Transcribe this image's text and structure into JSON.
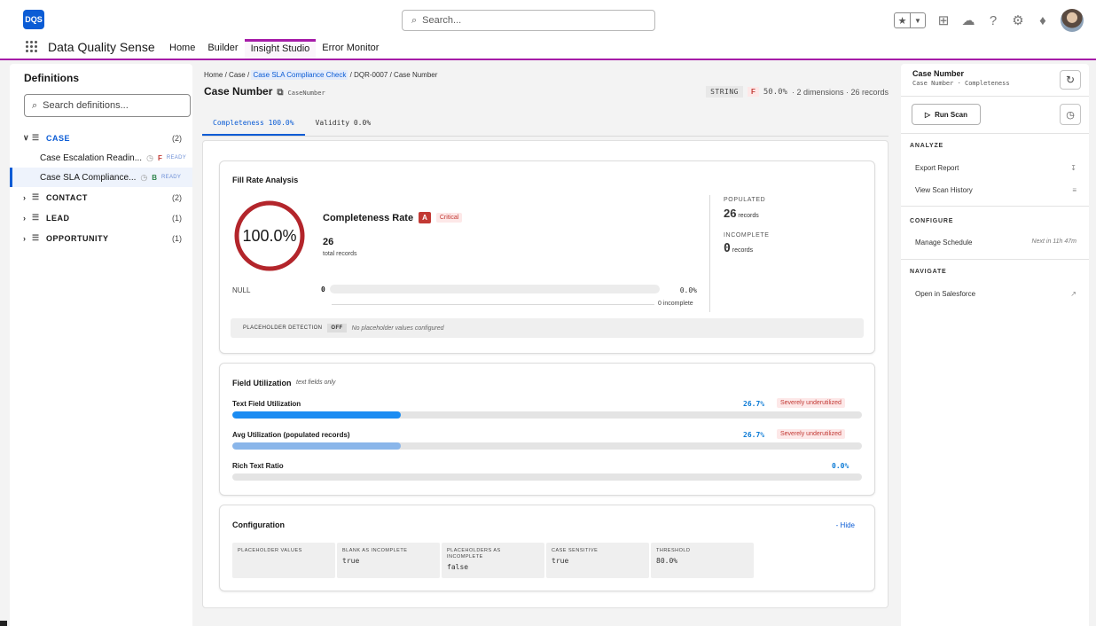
{
  "header": {
    "logo": "DQS",
    "search_placeholder": "Search...",
    "icons": [
      "favorites-star-icon",
      "favorites-dropdown-icon",
      "add-icon",
      "trailhead-icon",
      "help-icon",
      "setup-gear-icon",
      "notifications-bell-icon",
      "user-avatar"
    ]
  },
  "nav": {
    "app_name": "Data Quality Sense",
    "tabs": [
      {
        "label": "Home",
        "active": false
      },
      {
        "label": "Builder",
        "active": false
      },
      {
        "label": "Insight Studio",
        "active": true
      },
      {
        "label": "Error Monitor",
        "active": false
      }
    ]
  },
  "left": {
    "title": "Definitions",
    "search_placeholder": "Search definitions...",
    "objects": [
      {
        "name": "CASE",
        "count": "(2)",
        "expanded": true
      },
      {
        "name": "CONTACT",
        "count": "(2)",
        "expanded": false
      },
      {
        "name": "LEAD",
        "count": "(1)",
        "expanded": false
      },
      {
        "name": "OPPORTUNITY",
        "count": "(1)",
        "expanded": false
      }
    ],
    "definitions": [
      {
        "name": "Case Escalation Readin...",
        "grade": "F",
        "status": "READY"
      },
      {
        "name": "Case SLA Compliance...",
        "grade": "B",
        "status": "READY"
      }
    ]
  },
  "center": {
    "breadcrumb": {
      "home": "Home",
      "case": "Case",
      "check": "Case SLA Compliance Check",
      "id": "DQR-0007",
      "field": "Case Number",
      "sep": "/"
    },
    "field_title": "Case Number",
    "field_api": "CaseNumber",
    "field_type": "STRING",
    "field_grade": "F",
    "field_score": "50.0%",
    "field_meta": "· 2 dimensions · 26 records",
    "tabs": [
      "Completeness 100.0%",
      "Validity 0.0%"
    ],
    "fill": {
      "title": "Fill Rate Analysis",
      "ring_value": "100.0%",
      "rate_label": "Completeness Rate",
      "grade": "A",
      "severity": "Critical",
      "total": "26",
      "total_label": "total records",
      "null_label": "NULL",
      "null_count": "0",
      "null_pct": "0.0%",
      "incomplete": "0 incomplete",
      "populated_label": "POPULATED",
      "populated_value": "26",
      "populated_unit": "records",
      "incomplete_label": "INCOMPLETE",
      "incomplete_value": "0",
      "incomplete_unit": "records",
      "placeholder_label": "PLACEHOLDER DETECTION",
      "placeholder_state": "OFF",
      "placeholder_note": "No placeholder values configured"
    },
    "utilization": {
      "title": "Field Utilization",
      "subtitle": "text fields only",
      "rows": [
        {
          "label": "Text Field Utilization",
          "pct": "26.7%",
          "fraction": 0.267,
          "badge": "Severely underutilized",
          "color": "#1b8cf2"
        },
        {
          "label": "Avg Utilization (populated records)",
          "pct": "26.7%",
          "fraction": 0.267,
          "badge": "Severely underutilized",
          "color": "#8ab6ea"
        },
        {
          "label": "Rich Text Ratio",
          "pct": "0.0%",
          "fraction": 0,
          "badge": "",
          "color": "#1b8cf2"
        }
      ]
    },
    "config": {
      "title": "Configuration",
      "hide": "- Hide",
      "items": [
        {
          "label": "PLACEHOLDER VALUES",
          "value": ""
        },
        {
          "label": "BLANK AS INCOMPLETE",
          "value": "true"
        },
        {
          "label": "PLACEHOLDERS AS INCOMPLETE",
          "value": "false"
        },
        {
          "label": "CASE SENSITIVE",
          "value": "true"
        },
        {
          "label": "THRESHOLD",
          "value": "80.0%"
        }
      ]
    }
  },
  "right": {
    "title": "Case Number",
    "subtitle": "Case Number · Completeness",
    "run_scan": "Run Scan",
    "analyze_label": "ANALYZE",
    "export": "Export Report",
    "history": "View Scan History",
    "configure_label": "CONFIGURE",
    "schedule": "Manage Schedule",
    "schedule_next": "Next in 11h 47m",
    "navigate_label": "NAVIGATE",
    "salesforce": "Open in Salesforce"
  },
  "colors": {
    "accent": "#a61ca8",
    "brand": "#0b5cd5",
    "critical": "#c23934",
    "ring": "#b3252b"
  }
}
